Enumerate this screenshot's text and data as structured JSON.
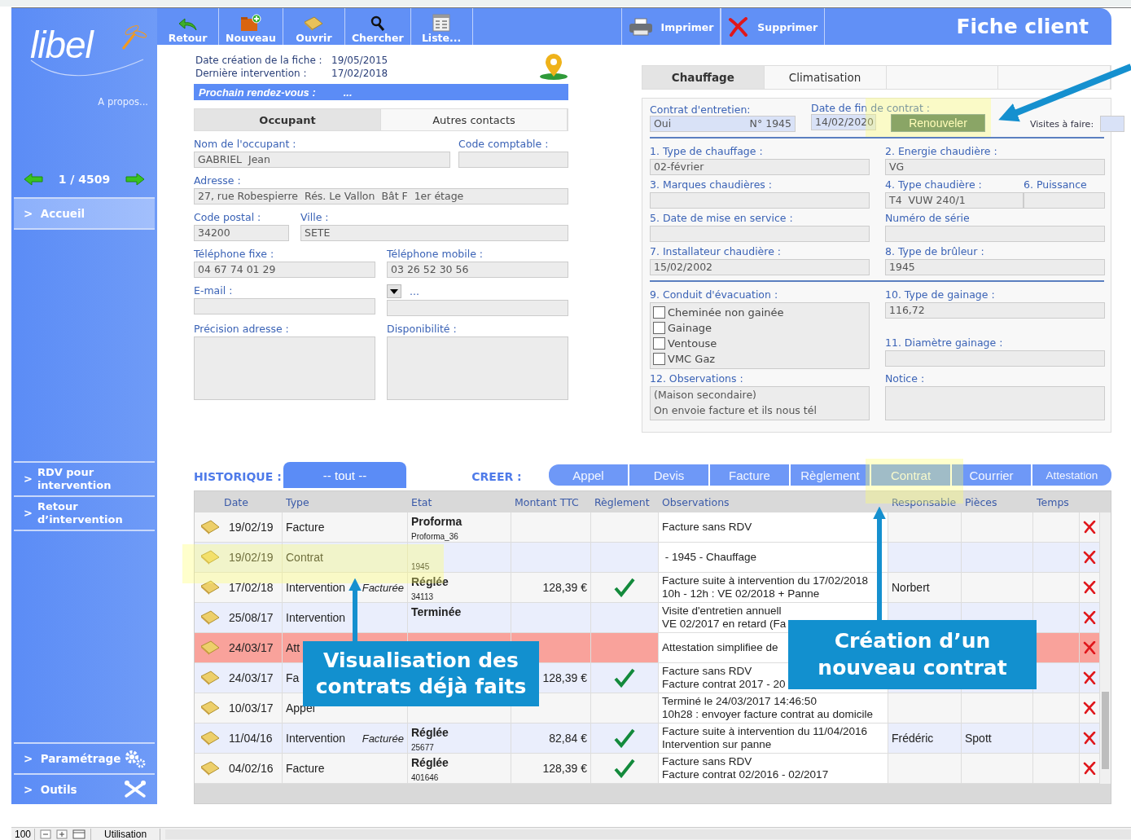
{
  "sidebar": {
    "logo": "libel",
    "about": "A propos...",
    "record": "1 / 4509",
    "nav": [
      {
        "prefix": ">",
        "label": "Accueil",
        "selected": true
      }
    ],
    "links": [
      {
        "prefix": ">",
        "label": "RDV pour intervention",
        "selected": false
      },
      {
        "prefix": ">",
        "label": "Retour d’intervention",
        "selected": false
      }
    ],
    "footer": [
      {
        "prefix": ">",
        "label": "Paramétrage"
      },
      {
        "prefix": ">",
        "label": "Outils"
      }
    ]
  },
  "toolbar": {
    "buttons": [
      {
        "label": "Retour"
      },
      {
        "label": "Nouveau"
      },
      {
        "label": "Ouvrir"
      },
      {
        "label": "Chercher"
      },
      {
        "label": "Liste..."
      }
    ],
    "actions": [
      {
        "label": "Imprimer"
      },
      {
        "label": "Supprimer"
      }
    ],
    "title": "Fiche client"
  },
  "info": {
    "created_label": "Date création de la fiche :",
    "created": "19/05/2015",
    "last_label": "Dernière intervention :",
    "last": "17/02/2018",
    "next_label": "Prochain rendez-vous  :",
    "next": "..."
  },
  "contact": {
    "tabs": [
      {
        "label": "Occupant",
        "selected": true
      },
      {
        "label": "Autres contacts",
        "selected": false
      }
    ],
    "rows": [
      [
        {
          "kind": "text",
          "label": "Nom de l'occupant :",
          "value": "GABRIEL  Jean"
        },
        {
          "kind": "text",
          "label": "Code comptable :"
        }
      ],
      [
        {
          "kind": "text",
          "label": "Adresse :",
          "value": "27, rue Robespierre  Rés. Le Vallon  Bât F  1er étage"
        }
      ],
      [
        {
          "kind": "text",
          "label": "Code postal :",
          "value": "34200"
        },
        {
          "kind": "text",
          "label": "Ville :",
          "value": "SETE"
        }
      ],
      [
        {
          "kind": "text",
          "label": "Téléphone fixe :",
          "value": "04 67 74 01 29"
        },
        {
          "kind": "text",
          "label": "Téléphone mobile :",
          "value": "03 26 52 30 56"
        }
      ],
      [
        {
          "kind": "text",
          "label": "E-mail :"
        },
        {
          "kind": "select",
          "label": "..."
        }
      ],
      [
        {
          "kind": "area",
          "label": "Précision adresse :"
        },
        {
          "kind": "area",
          "label": "Disponibilité :"
        }
      ]
    ]
  },
  "heating": {
    "tabs": [
      {
        "label": "Chauffage",
        "selected": true
      },
      {
        "label": "Climatisation",
        "selected": false
      }
    ],
    "contract": {
      "label": "Contrat  d'entretien:",
      "value": "Oui",
      "number": "N° 1945",
      "end_label": "Date de fin de contrat :",
      "end": "14/02/2020",
      "renew": "Renouveler",
      "visits_label": "Visites à faire:"
    },
    "rows": [
      [
        {
          "label": "1. Type de chauffage :",
          "value": "02-février"
        },
        {
          "label": "2. Energie chaudière :",
          "value": "VG"
        }
      ],
      [
        {
          "label": "3. Marques chaudières :"
        },
        {
          "label": "4. Type chaudière :",
          "value": "T4  VUW 240/1",
          "extra": {
            "label": "6. Puissance"
          }
        }
      ],
      [
        {
          "label": "5. Date de mise en service :"
        },
        {
          "label": "Numéro de série"
        }
      ],
      [
        {
          "label": "7. Installateur chaudière :",
          "value": "15/02/2002"
        },
        {
          "label": "8. Type de brûleur :",
          "value": "1945"
        }
      ]
    ],
    "evacuation": {
      "label": "9. Conduit d'évacuation  :",
      "options": [
        {
          "label": "Cheminée non gainée",
          "checked": false
        },
        {
          "label": "Gainage",
          "checked": false
        },
        {
          "label": "Ventouse",
          "checked": false
        },
        {
          "label": "VMC Gaz",
          "checked": false
        }
      ]
    },
    "gainage": [
      {
        "label": "10. Type de gainage :",
        "value": "116,72"
      },
      {
        "label": "11. Diamètre gainage :"
      }
    ],
    "observations": {
      "label": "12. Observations :",
      "lines": [
        "(Maison secondaire)",
        "On envoie facture et ils nous tél"
      ]
    },
    "notice": {
      "label": "Notice :"
    }
  },
  "history": {
    "label": "HISTORIQUE :",
    "filter": "-- tout --",
    "create_label": "CREER :",
    "create_buttons": [
      "Appel",
      "Devis",
      "Facture",
      "Règlement",
      "Contrat",
      "Courrier",
      "Attestation"
    ],
    "columns": [
      "Date",
      "Type",
      "Etat",
      "Montant TTC",
      "Règlement",
      "Observations",
      "Responsable",
      "Pièces",
      "Temps"
    ],
    "rows": [
      {
        "date": "19/02/19",
        "type": "Facture",
        "state": "Proforma",
        "ref": "Proforma_36",
        "paid": false,
        "alert": false,
        "obs": [
          "Facture sans RDV"
        ]
      },
      {
        "date": "19/02/19",
        "type": "Contrat",
        "ref": "1945",
        "paid": false,
        "alert": false,
        "obs": [
          " - 1945 - Chauffage"
        ]
      },
      {
        "date": "17/02/18",
        "type": "Intervention",
        "note": "Facturée",
        "state": "Réglée",
        "ref": "34113",
        "amount": "128,39 €",
        "paid": true,
        "alert": false,
        "obs": [
          "Facture suite à intervention du 17/02/2018",
          "10h - 12h : VE 02/2018 + Panne"
        ],
        "responsible": "Norbert"
      },
      {
        "date": "25/08/17",
        "type": "Intervention",
        "state": "Terminée",
        "paid": false,
        "alert": false,
        "obs": [
          "Visite d'entretien annuell",
          "VE 02/2017 en retard (Fa"
        ]
      },
      {
        "date": "24/03/17",
        "type": "Att",
        "paid": false,
        "alert": true,
        "obs": [
          "Attestation simplifiee de"
        ]
      },
      {
        "date": "24/03/17",
        "type": "Fa",
        "amount": "128,39 €",
        "paid": true,
        "alert": false,
        "obs": [
          "Facture sans RDV",
          "Facture contrat 2017 - 20"
        ]
      },
      {
        "date": "10/03/17",
        "type": "Appel",
        "paid": false,
        "alert": false,
        "obs": [
          "Terminé le 24/03/2017 14:46:50",
          "10h28 : envoyer facture contrat au domicile"
        ]
      },
      {
        "date": "11/04/16",
        "type": "Intervention",
        "note": "Facturée",
        "state": "Réglée",
        "ref": "25677",
        "amount": "82,84 €",
        "paid": true,
        "alert": false,
        "obs": [
          "Facture suite à intervention du 11/04/2016",
          "Intervention sur panne"
        ],
        "responsible": "Frédéric",
        "parts": "Spott"
      },
      {
        "date": "04/02/16",
        "type": "Facture",
        "state": "Réglée",
        "ref": "401646",
        "amount": "128,39 €",
        "paid": true,
        "alert": false,
        "obs": [
          "Facture sans RDV",
          "Facture contrat 02/2016 - 02/2017"
        ]
      }
    ]
  },
  "annotations": [
    {
      "text": "Visualisation des contrats déjà faits"
    },
    {
      "text": "Création d’un nouveau contrat"
    }
  ],
  "status_bar": {
    "zoom": "100",
    "mode": "Utilisation"
  }
}
